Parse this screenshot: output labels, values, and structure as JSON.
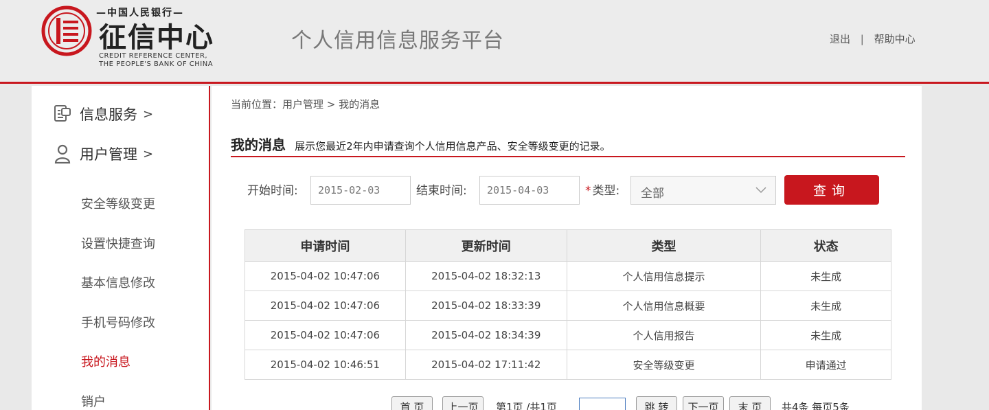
{
  "header": {
    "logo_top": "—中国人民银行—",
    "logo_main": "征信中心",
    "logo_en_line1": "CREDIT REFERENCE CENTER,",
    "logo_en_line2": "THE PEOPLE'S BANK OF CHINA",
    "platform_title": "个人信用信息服务平台",
    "logout": "退出",
    "separator": "|",
    "help": "帮助中心",
    "accent_color": "#c8171e"
  },
  "sidebar": {
    "main_items": [
      {
        "label": "信息服务",
        "arrow": ">",
        "icon": "document-icon"
      },
      {
        "label": "用户管理",
        "arrow": ">",
        "icon": "user-icon"
      }
    ],
    "sub_items": [
      {
        "label": "安全等级变更"
      },
      {
        "label": "设置快捷查询"
      },
      {
        "label": "基本信息修改"
      },
      {
        "label": "手机号码修改"
      },
      {
        "label": "我的消息",
        "active": true
      },
      {
        "label": "销户"
      }
    ]
  },
  "breadcrumb": "当前位置：用户管理 > 我的消息",
  "section": {
    "title": "我的消息",
    "description": "展示您最近2年内申请查询个人信用信息产品、安全等级变更的记录。"
  },
  "filters": {
    "start_label": "开始时间:",
    "start_value": "2015-02-03",
    "end_label": "结束时间:",
    "end_value": "2015-04-03",
    "required_mark": "*",
    "type_label": "类型:",
    "type_value": "全部",
    "query_button": "查询"
  },
  "table": {
    "headers": [
      "申请时间",
      "更新时间",
      "类型",
      "状态"
    ],
    "rows": [
      [
        "2015-04-02 10:47:06",
        "2015-04-02 18:32:13",
        "个人信用信息提示",
        "未生成"
      ],
      [
        "2015-04-02 10:47:06",
        "2015-04-02 18:33:39",
        "个人信用信息概要",
        "未生成"
      ],
      [
        "2015-04-02 10:47:06",
        "2015-04-02 18:34:39",
        "个人信用报告",
        "未生成"
      ],
      [
        "2015-04-02 10:46:51",
        "2015-04-02 17:11:42",
        "安全等级变更",
        "申请通过"
      ]
    ]
  },
  "pagination": {
    "first": "首 页",
    "prev": "上一页",
    "page_info": "第1页 /共1页",
    "jump_input": "",
    "jump": "跳 转",
    "next": "下一页",
    "last": "末 页",
    "summary": "共4条 每页5条"
  }
}
